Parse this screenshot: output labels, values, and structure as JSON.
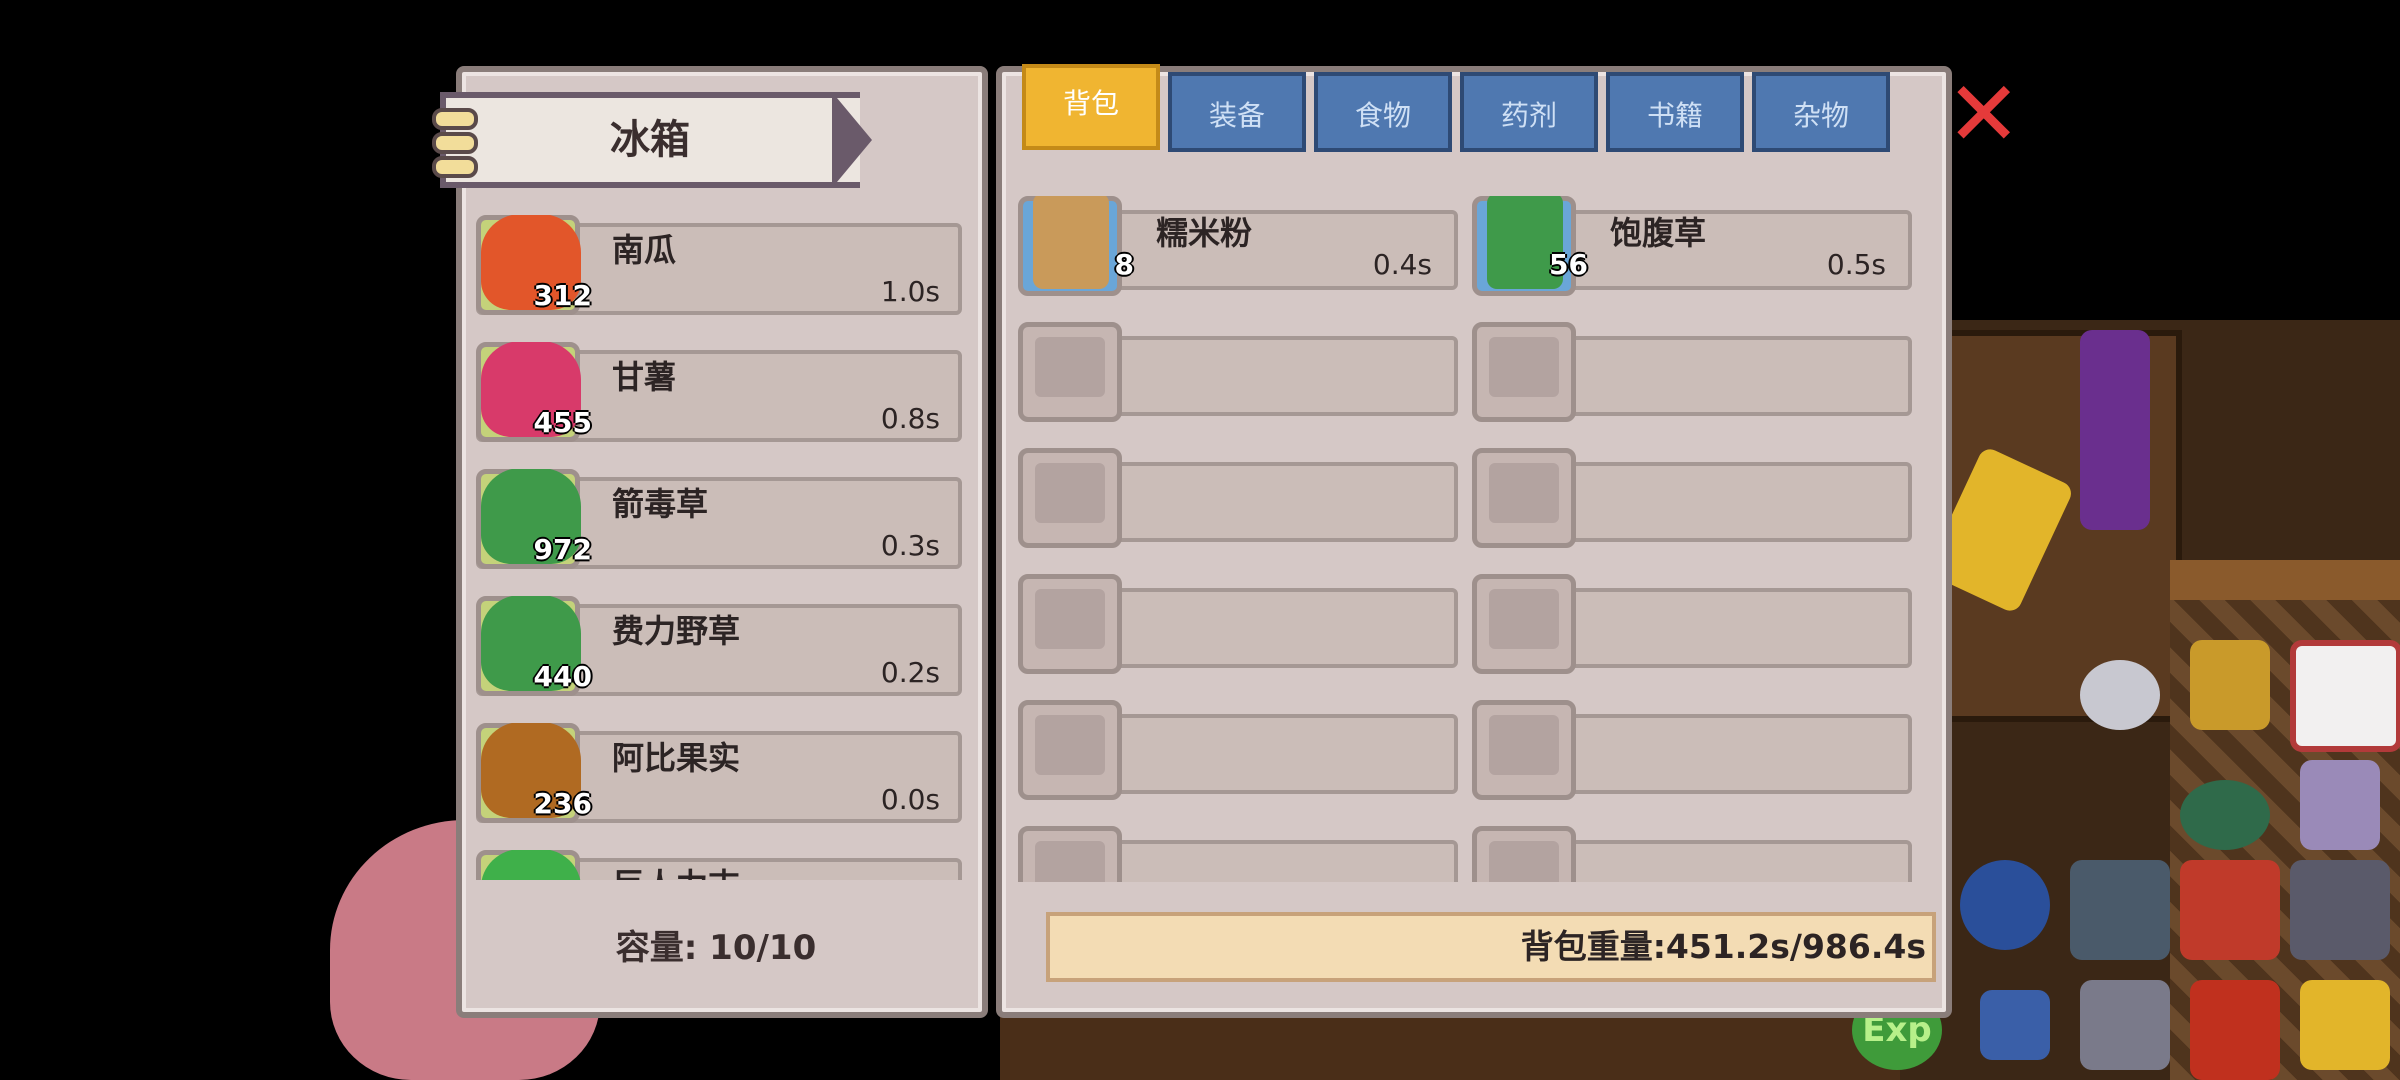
{
  "fridge": {
    "title": "冰箱",
    "items": [
      {
        "name": "南瓜",
        "count": "312",
        "time": "1.0s",
        "icon": "pumpkin-icon"
      },
      {
        "name": "甘薯",
        "count": "455",
        "time": "0.8s",
        "icon": "sweet-potato-icon"
      },
      {
        "name": "箭毒草",
        "count": "972",
        "time": "0.3s",
        "icon": "arrow-poison-herb-icon"
      },
      {
        "name": "费力野草",
        "count": "440",
        "time": "0.2s",
        "icon": "wild-herb-icon"
      },
      {
        "name": "阿比果实",
        "count": "236",
        "time": "0.0s",
        "icon": "acorn-icon"
      },
      {
        "name": "巨人力吉",
        "icon": "green-plant-icon"
      }
    ],
    "capacity": "容量: 10/10"
  },
  "bag": {
    "tabs": [
      "背包",
      "装备",
      "食物",
      "药剂",
      "书籍",
      "杂物"
    ],
    "active_tab": "背包",
    "items": [
      {
        "name": "糯米粉",
        "count": "8",
        "time": "0.4s",
        "icon": "flour-scroll-icon"
      },
      {
        "name": "饱腹草",
        "count": "56",
        "time": "0.5s",
        "icon": "palm-herb-icon"
      }
    ],
    "weight": "背包重量:451.2s/986.4s"
  },
  "hud": {
    "exp_label": "Exp"
  },
  "colors": {
    "tab_active": "#f0b531",
    "tab_inactive": "#4f78b0",
    "close": "#e53a3a",
    "panel_bg": "#d5c8c6"
  }
}
